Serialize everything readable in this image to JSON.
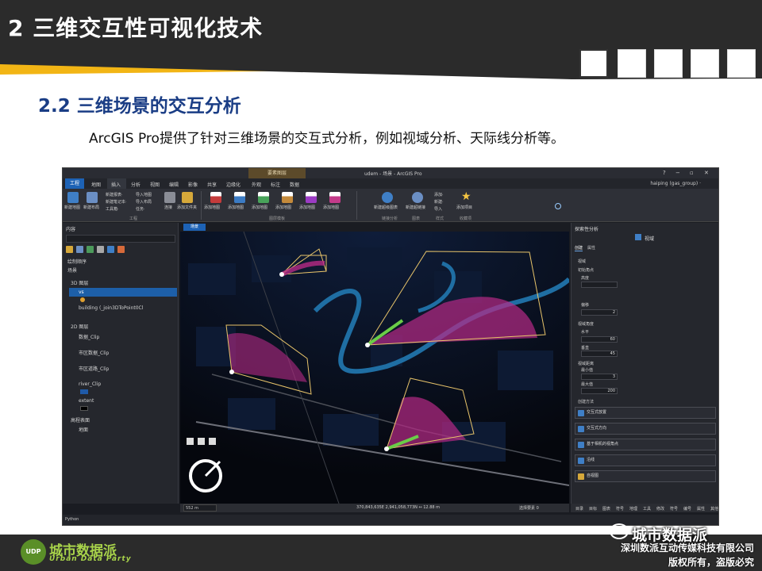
{
  "slide": {
    "header_title": "2 三维交互性可视化技术",
    "section_title": "2.2 三维场景的交互分析",
    "description": "ArcGIS Pro提供了针对三维场景的交互式分析，例如视域分析、天际线分析等。",
    "colors": {
      "header_bg": "#2b2b2b",
      "accent_yellow": "#f2b515",
      "section_title": "#1a3d85",
      "logo_green": "#a8d34a"
    }
  },
  "app": {
    "window_title": "udem - 场景 - ArcGIS Pro",
    "context_tab": "要素图层",
    "ribbon_tabs": [
      "工程",
      "地图",
      "插入",
      "分析",
      "视图",
      "编辑",
      "影像",
      "共享",
      "边缘化",
      "外观",
      "标注",
      "数据"
    ],
    "active_tab": "工程",
    "user": "haiping (gas_group) ·",
    "ribbon_small": [
      "新建报表·",
      "新建笔记本·",
      "工具箱·",
      "导入地图",
      "导入布局",
      "任务·",
      "连接",
      "添加文件夹",
      "添加·",
      "新建·",
      "导入"
    ],
    "ribbon_buttons": [
      "新建地图",
      "新建布局",
      "添加文件夹",
      "添加地图",
      "添加地图",
      "添加地图",
      "添加地图",
      "添加地图",
      "添加地图",
      "新建超级图表",
      "新建超链接",
      "添加项目"
    ],
    "ribbon_groups": [
      "工程",
      "图层模板",
      "链接分析",
      "图表",
      "样式",
      "收藏项"
    ],
    "content_pane": {
      "title": "内容",
      "tree": [
        {
          "label": "绘制顺序"
        },
        {
          "label": "场景"
        },
        {
          "label": "3D 图层"
        },
        {
          "label": "vs"
        },
        {
          "label": "building (_join3DToPoint0Cl"
        },
        {
          "label": "2D 图层"
        },
        {
          "label": "数据_Clip"
        },
        {
          "label": "市区数据_Clip"
        },
        {
          "label": "市区道路_Clip"
        },
        {
          "label": "river_Clip"
        },
        {
          "label": "extent"
        },
        {
          "label": "高程表面"
        },
        {
          "label": "地面"
        }
      ]
    },
    "view_tab": "场景",
    "status": {
      "scale": "552 m",
      "coords": "370,843,635E 2,941,058,773N ↔ 12.88 m",
      "mode": "选择要素 0"
    },
    "bottom_bar": "Python",
    "right_pane": {
      "title": "探索性分析",
      "tool": "视域",
      "tabs": [
        "创建",
        "属性"
      ],
      "fields": [
        {
          "label": "视域",
          "value": ""
        },
        {
          "label": "初始角点",
          "value": ""
        },
        {
          "label": "高度",
          "value": ""
        },
        {
          "label": "偏移",
          "value": "2"
        },
        {
          "label": "视域角度",
          "value": ""
        },
        {
          "label": "水平",
          "value": "60"
        },
        {
          "label": "垂直",
          "value": "45"
        },
        {
          "label": "视域距离",
          "value": ""
        },
        {
          "label": "最小值",
          "value": "3"
        },
        {
          "label": "最大值",
          "value": "200"
        }
      ],
      "method_label": "创建方法",
      "methods": [
        "交互式放置",
        "交互式方向",
        "基于相机的视角点",
        "沿线",
        "自视图"
      ],
      "bottom_items": [
        "目录",
        "目标",
        "图表",
        "符号",
        "地理",
        "工具",
        "修改",
        "符号",
        "编号",
        "属性",
        "其他"
      ]
    }
  },
  "footer": {
    "logo_cn": "城市数据派",
    "logo_en": "Urban Data Party",
    "watermark": "城市数据派",
    "copyright_line1": "深圳数派互动传媒科技有限公司",
    "copyright_line2": "版权所有，盗版必究"
  }
}
